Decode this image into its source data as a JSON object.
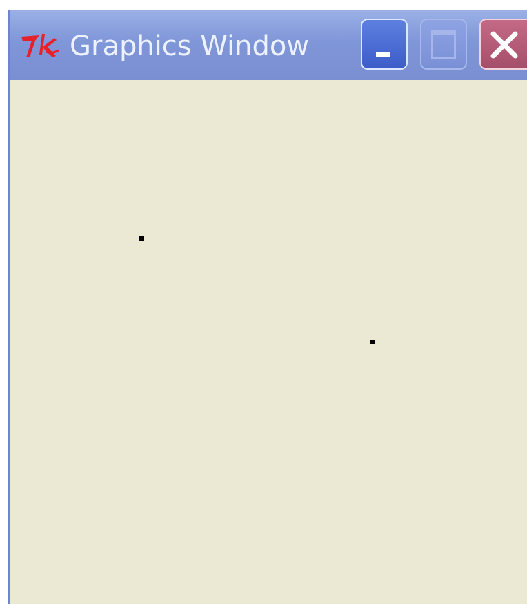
{
  "window": {
    "title": "Graphics Window",
    "app_icon": "tk-logo-icon"
  },
  "controls": {
    "minimize": "minimize-icon",
    "maximize": "maximize-icon",
    "close": "close-icon"
  },
  "colors": {
    "titlebar": "#7f96d8",
    "title_text": "#eef2ff",
    "canvas_background": "#ebe8d3",
    "tk_logo": "#e8202a",
    "close_button": "#b45c78",
    "point": "#000000"
  }
}
